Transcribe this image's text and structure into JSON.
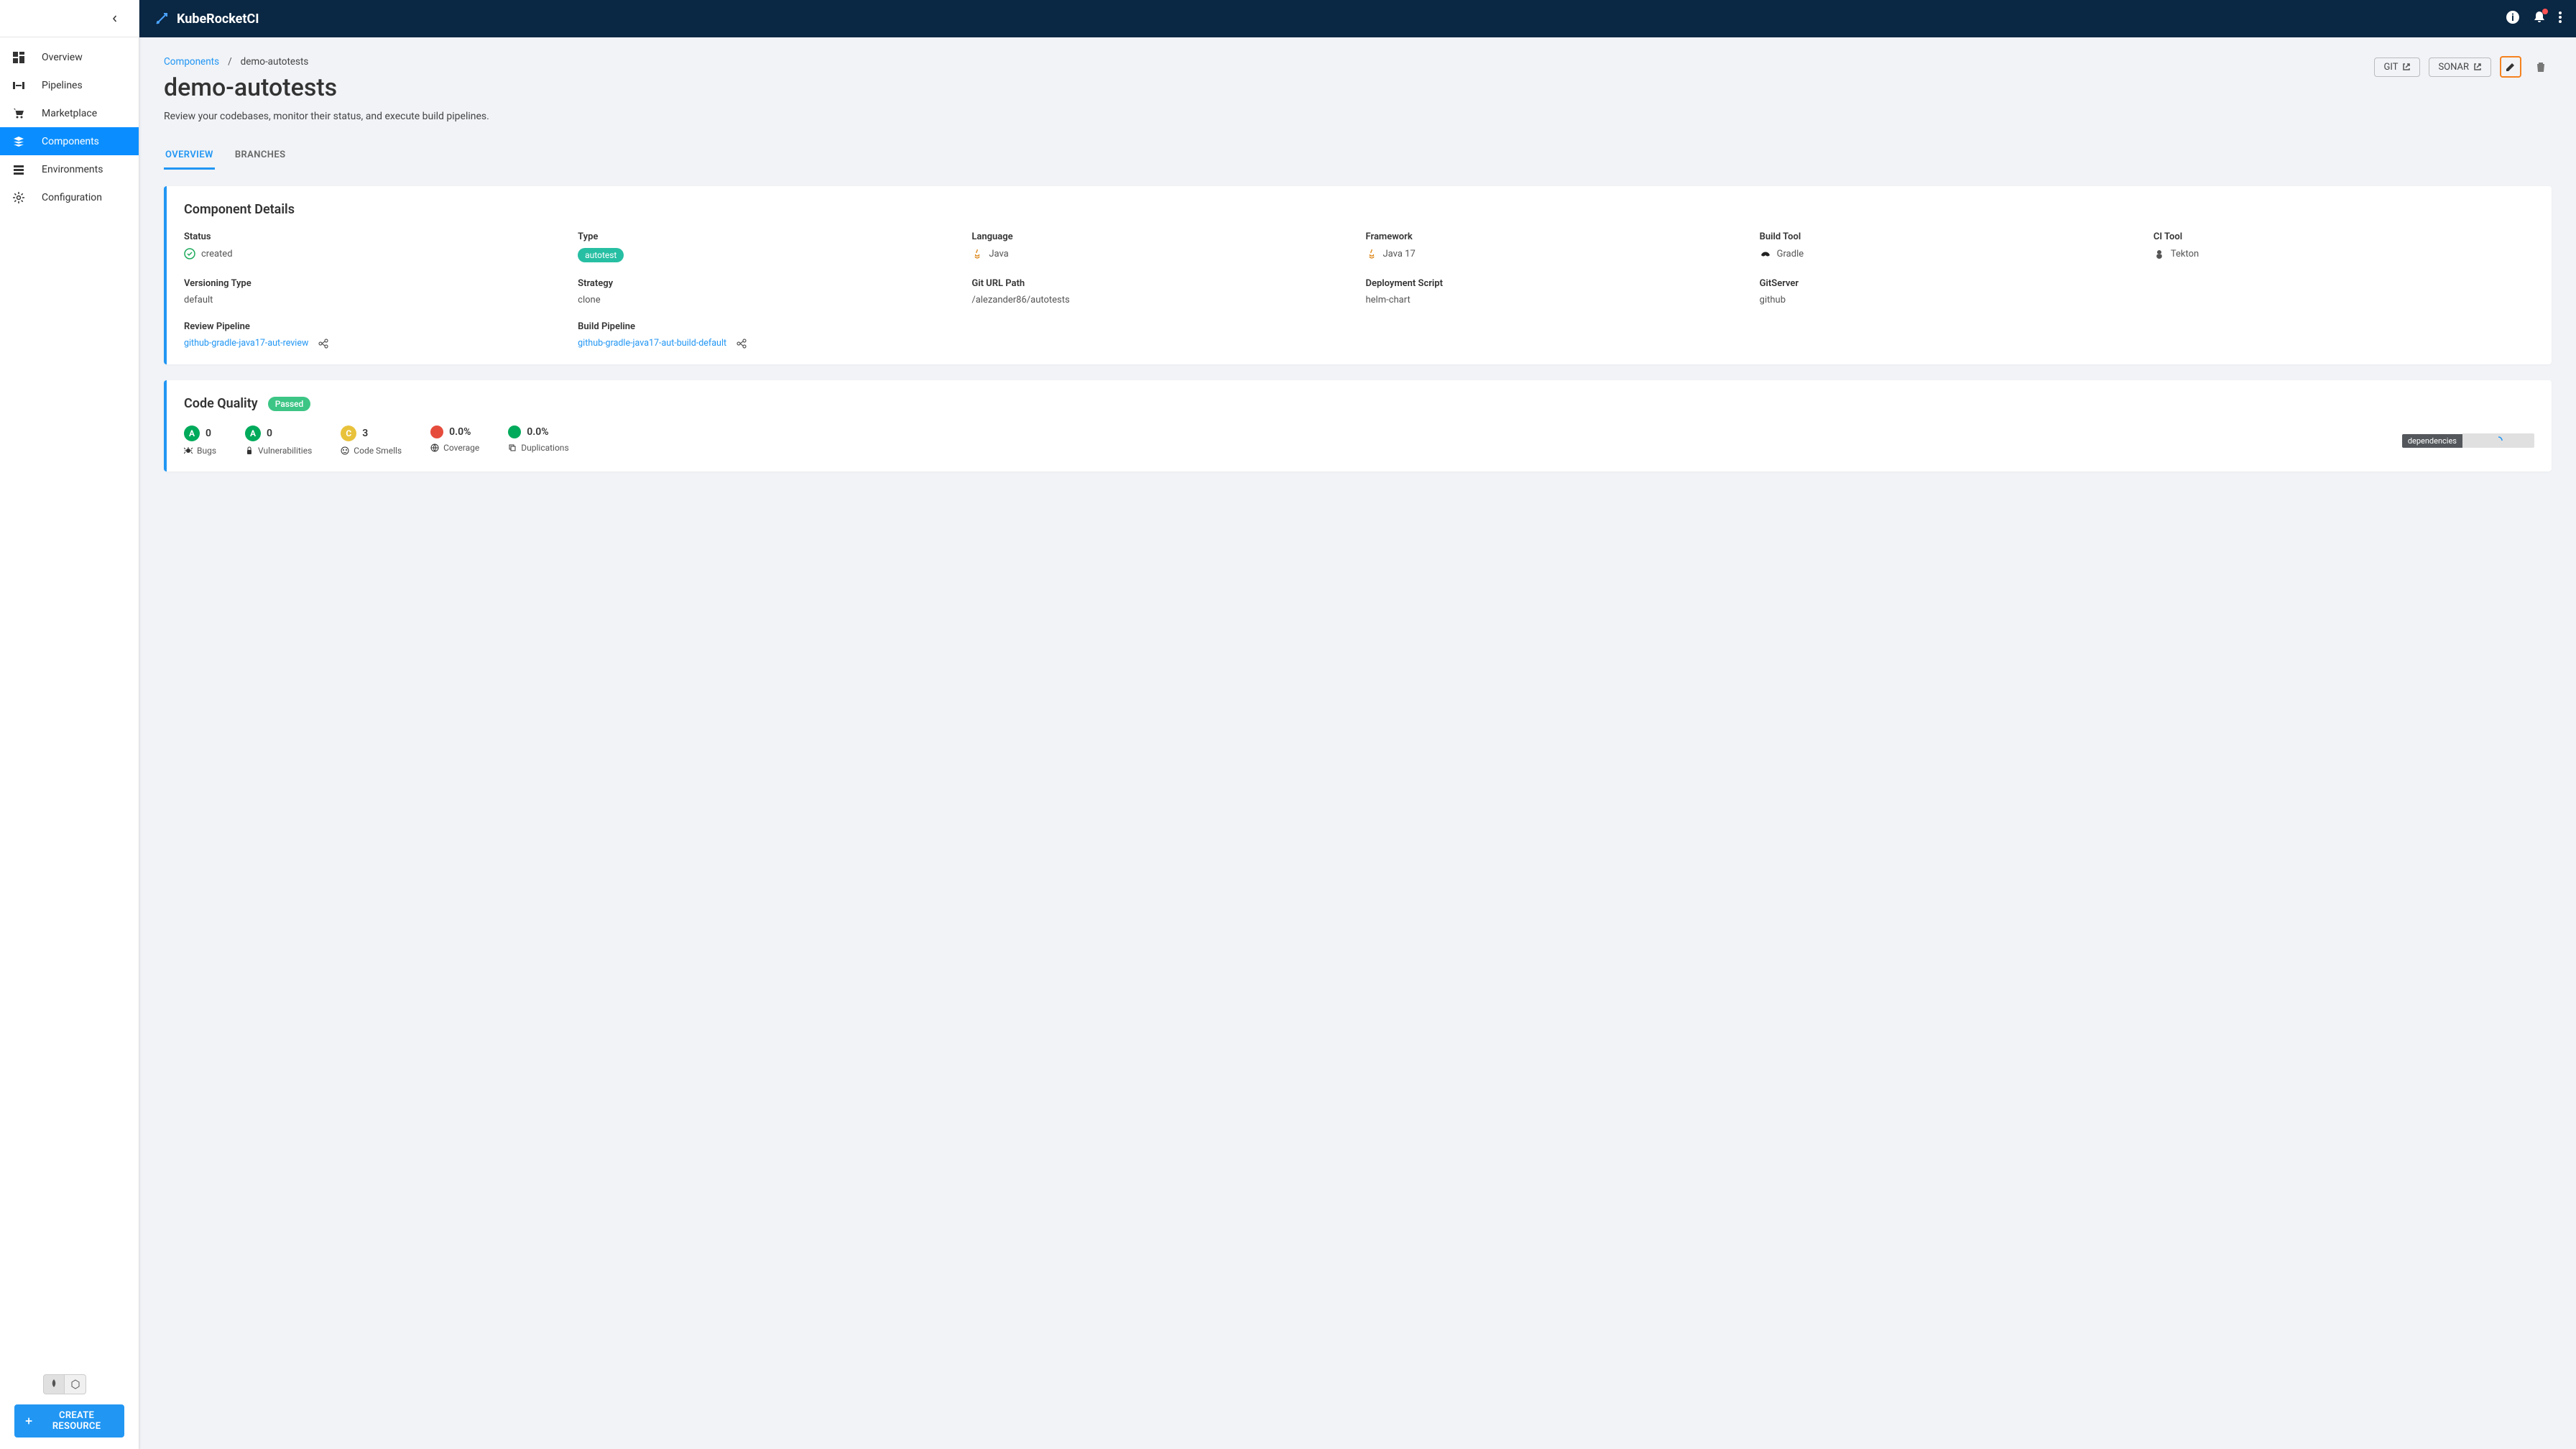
{
  "brand": "KubeRocketCI",
  "sidebar": {
    "items": [
      {
        "label": "Overview",
        "icon": "dashboard"
      },
      {
        "label": "Pipelines",
        "icon": "pipeline"
      },
      {
        "label": "Marketplace",
        "icon": "cart"
      },
      {
        "label": "Components",
        "icon": "layers",
        "active": true
      },
      {
        "label": "Environments",
        "icon": "envs"
      },
      {
        "label": "Configuration",
        "icon": "gear"
      }
    ],
    "create_resource_label": "CREATE RESOURCE"
  },
  "breadcrumb": {
    "root": "Components",
    "current": "demo-autotests"
  },
  "page": {
    "title": "demo-autotests",
    "description": "Review your codebases, monitor their status, and execute build pipelines."
  },
  "actions": {
    "git_label": "GIT",
    "sonar_label": "SONAR"
  },
  "tabs": [
    {
      "label": "OVERVIEW",
      "active": true
    },
    {
      "label": "BRANCHES"
    }
  ],
  "component_details": {
    "title": "Component Details",
    "fields": {
      "status": {
        "label": "Status",
        "value": "created"
      },
      "type": {
        "label": "Type",
        "value": "autotest"
      },
      "language": {
        "label": "Language",
        "value": "Java"
      },
      "framework": {
        "label": "Framework",
        "value": "Java 17"
      },
      "build_tool": {
        "label": "Build Tool",
        "value": "Gradle"
      },
      "ci_tool": {
        "label": "CI Tool",
        "value": "Tekton"
      },
      "versioning_type": {
        "label": "Versioning Type",
        "value": "default"
      },
      "strategy": {
        "label": "Strategy",
        "value": "clone"
      },
      "git_url_path": {
        "label": "Git URL Path",
        "value": "/alezander86/autotests"
      },
      "deployment_script": {
        "label": "Deployment Script",
        "value": "helm-chart"
      },
      "git_server": {
        "label": "GitServer",
        "value": "github"
      },
      "review_pipeline": {
        "label": "Review Pipeline",
        "value": "github-gradle-java17-aut-review"
      },
      "build_pipeline": {
        "label": "Build Pipeline",
        "value": "github-gradle-java17-aut-build-default"
      }
    }
  },
  "code_quality": {
    "title": "Code Quality",
    "status": "Passed",
    "metrics": {
      "bugs": {
        "rating": "A",
        "value": "0",
        "label": "Bugs"
      },
      "vulnerabilities": {
        "rating": "A",
        "value": "0",
        "label": "Vulnerabilities"
      },
      "code_smells": {
        "rating": "C",
        "value": "3",
        "label": "Code Smells"
      },
      "coverage": {
        "value": "0.0%",
        "label": "Coverage"
      },
      "duplications": {
        "value": "0.0%",
        "label": "Duplications"
      }
    },
    "dependencies_label": "dependencies"
  }
}
